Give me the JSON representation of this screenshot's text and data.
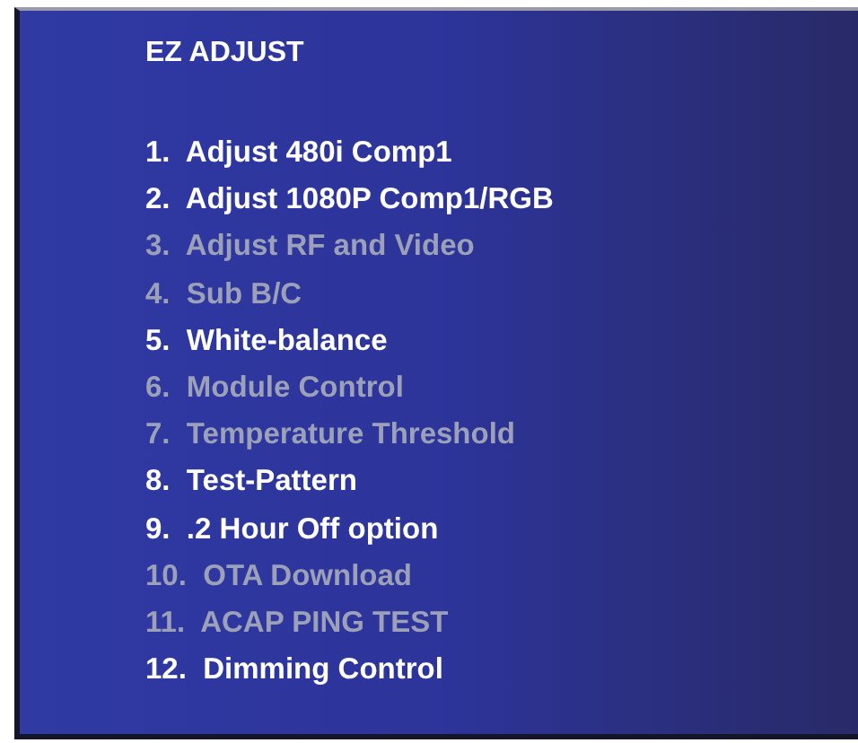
{
  "menu": {
    "title": "EZ ADJUST",
    "items": [
      {
        "label": "1.  Adjust 480i Comp1",
        "disabled": false
      },
      {
        "label": "2.  Adjust 1080P Comp1/RGB",
        "disabled": false
      },
      {
        "label": "3.  Adjust RF and Video",
        "disabled": true
      },
      {
        "label": "4.  Sub B/C",
        "disabled": true
      },
      {
        "label": "5.  White-balance",
        "disabled": false
      },
      {
        "label": "6.  Module Control",
        "disabled": true
      },
      {
        "label": "7.  Temperature Threshold",
        "disabled": true
      },
      {
        "label": "8.  Test-Pattern",
        "disabled": false
      },
      {
        "label": "9.  .2 Hour Off option",
        "disabled": false
      },
      {
        "label": "10.  OTA Download",
        "disabled": true
      },
      {
        "label": "11.  ACAP PING TEST",
        "disabled": true
      },
      {
        "label": "12.  Dimming Control",
        "disabled": false
      }
    ]
  }
}
